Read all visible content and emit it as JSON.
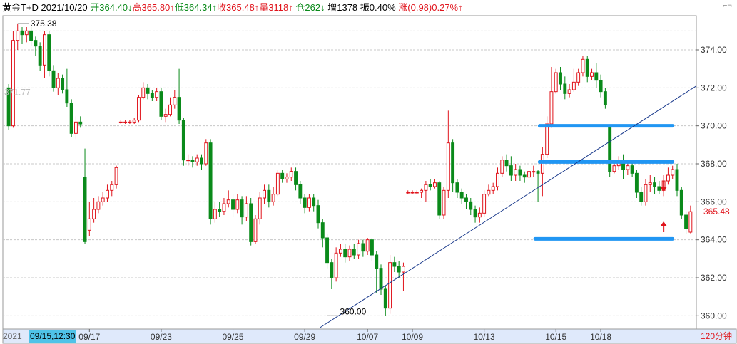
{
  "header": {
    "instrument": "黄金T+D",
    "date": "2021/10/20",
    "open": "开364.40↓",
    "high": "高365.80↑",
    "low": "低364.34↑",
    "close": "收365.48↑",
    "volume": "量3118↑",
    "position": "仓262↓",
    "increase": "增1378",
    "amplitude": "振0.40%",
    "change": "涨(0.98)0.27%↑"
  },
  "xbar": {
    "year": "2021",
    "cursor": "09/15,12:30",
    "period": "120分钟"
  },
  "colors": {
    "up": "#e0141c",
    "down": "#0a8a1a",
    "support_line": "#2196f3",
    "trend_line": "#1a3a8c",
    "grid": "#c8c8c8"
  },
  "chart_data": {
    "type": "candlestick",
    "title": "",
    "xlabel": "",
    "ylabel": "",
    "ylim": [
      359.3,
      375.8
    ],
    "yticks": [
      360.0,
      362.0,
      364.0,
      366.0,
      368.0,
      370.0,
      372.0,
      374.0
    ],
    "ytick_labels": [
      "360.00",
      "362.00",
      "364.00",
      "366.00",
      "368.00",
      "370.00",
      "372.00",
      "374.00"
    ],
    "xtick_labels": [
      {
        "index": 18,
        "label": "09/17"
      },
      {
        "index": 34,
        "label": "09/23"
      },
      {
        "index": 50,
        "label": "09/25"
      },
      {
        "index": 66,
        "label": "09/29"
      },
      {
        "index": 80,
        "label": "10/07"
      },
      {
        "index": 90,
        "label": "10/09"
      },
      {
        "index": 106,
        "label": "10/13"
      },
      {
        "index": 122,
        "label": "10/15"
      },
      {
        "index": 132,
        "label": "10/18"
      }
    ],
    "annotations": [
      {
        "label": "375.38",
        "index": 2,
        "value": 375.38
      },
      {
        "label": "360.00",
        "index": 71,
        "value": 360.0
      },
      {
        "label": "371.77",
        "index": 0,
        "value": 371.77,
        "faded": true
      },
      {
        "label": "365.48",
        "value": 365.48,
        "kind": "last-price"
      }
    ],
    "support_lines": [
      {
        "value": 370.0,
        "from_index": 119,
        "to_index": 148
      },
      {
        "value": 368.1,
        "from_index": 119,
        "to_index": 148
      },
      {
        "value": 364.05,
        "from_index": 118,
        "to_index": 148
      }
    ],
    "trend_line": {
      "from": {
        "index": 71,
        "value": 359.6
      },
      "to": {
        "index": 148,
        "value": 372.1
      }
    },
    "arrows": [
      {
        "index": 146,
        "value": 366.8,
        "direction": "down"
      },
      {
        "index": 146,
        "value": 364.7,
        "direction": "up"
      }
    ],
    "candles": [
      [
        372.0,
        370.0,
        372.2,
        369.8
      ],
      [
        370.0,
        374.5,
        375.0,
        369.9
      ],
      [
        374.5,
        375.0,
        375.38,
        374.0
      ],
      [
        375.0,
        374.8,
        375.2,
        374.3
      ],
      [
        374.8,
        375.0,
        375.2,
        374.4
      ],
      [
        375.0,
        374.5,
        375.2,
        374.2
      ],
      [
        374.5,
        374.2,
        374.7,
        373.7
      ],
      [
        374.2,
        373.2,
        374.4,
        372.9
      ],
      [
        373.2,
        374.8,
        375.0,
        372.5
      ],
      [
        374.8,
        372.9,
        375.0,
        372.6
      ],
      [
        372.9,
        372.0,
        373.2,
        371.8
      ],
      [
        372.0,
        372.5,
        372.8,
        371.6
      ],
      [
        372.5,
        371.9,
        372.7,
        371.7
      ],
      [
        371.9,
        371.2,
        373.0,
        371.0
      ],
      [
        371.2,
        369.6,
        371.4,
        369.4
      ],
      [
        369.6,
        370.2,
        370.5,
        369.3
      ],
      [
        370.2,
        370.1,
        370.5,
        369.9
      ],
      [
        367.3,
        363.9,
        368.8,
        363.8
      ],
      [
        364.5,
        365.1,
        366.0,
        364.2
      ],
      [
        365.1,
        365.6,
        366.2,
        364.9
      ],
      [
        365.6,
        366.0,
        366.3,
        365.4
      ],
      [
        366.0,
        366.2,
        366.5,
        365.8
      ],
      [
        366.2,
        366.6,
        366.9,
        366.0
      ],
      [
        366.6,
        366.9,
        367.1,
        366.3
      ],
      [
        366.9,
        367.8,
        367.9,
        366.7
      ],
      [
        370.2,
        370.2,
        370.3,
        370.1
      ],
      [
        370.2,
        370.2,
        370.3,
        370.1
      ],
      [
        370.2,
        370.2,
        370.3,
        370.1
      ],
      [
        370.2,
        370.3,
        370.4,
        370.1
      ],
      [
        370.3,
        371.5,
        371.6,
        370.2
      ],
      [
        371.5,
        372.0,
        372.3,
        371.4
      ],
      [
        372.0,
        371.7,
        372.2,
        371.4
      ],
      [
        371.7,
        371.5,
        371.9,
        371.3
      ],
      [
        371.5,
        371.8,
        372.0,
        371.3
      ],
      [
        371.8,
        370.5,
        372.0,
        370.3
      ],
      [
        370.5,
        370.6,
        370.9,
        370.2
      ],
      [
        370.6,
        371.1,
        371.5,
        370.5
      ],
      [
        371.1,
        371.5,
        371.9,
        370.9
      ],
      [
        371.5,
        370.3,
        373.0,
        370.1
      ],
      [
        370.3,
        368.2,
        370.4,
        367.9
      ],
      [
        368.2,
        368.2,
        368.5,
        367.9
      ],
      [
        368.2,
        368.1,
        368.4,
        367.8
      ],
      [
        368.1,
        368.3,
        368.5,
        367.9
      ],
      [
        368.3,
        368.0,
        368.5,
        367.7
      ],
      [
        368.0,
        369.1,
        369.3,
        367.9
      ],
      [
        369.1,
        365.1,
        369.3,
        364.8
      ],
      [
        365.1,
        365.6,
        366.0,
        364.9
      ],
      [
        365.6,
        365.5,
        366.0,
        365.2
      ],
      [
        365.5,
        365.9,
        366.2,
        365.3
      ],
      [
        365.9,
        366.1,
        366.6,
        365.7
      ],
      [
        366.1,
        365.6,
        366.4,
        365.2
      ],
      [
        365.6,
        366.1,
        366.4,
        365.4
      ],
      [
        366.1,
        365.2,
        366.3,
        364.8
      ],
      [
        365.2,
        365.9,
        366.3,
        365.0
      ],
      [
        365.9,
        363.9,
        366.2,
        363.7
      ],
      [
        363.9,
        365.1,
        365.3,
        363.8
      ],
      [
        365.1,
        366.2,
        366.5,
        364.8
      ],
      [
        366.2,
        366.6,
        366.9,
        365.9
      ],
      [
        366.6,
        366.0,
        366.9,
        365.7
      ],
      [
        366.0,
        366.4,
        366.8,
        365.8
      ],
      [
        366.4,
        367.5,
        367.7,
        366.3
      ],
      [
        367.5,
        367.2,
        367.7,
        367.0
      ],
      [
        367.2,
        367.3,
        367.5,
        367.0
      ],
      [
        367.3,
        367.6,
        367.8,
        367.1
      ],
      [
        367.6,
        366.9,
        367.8,
        366.6
      ],
      [
        366.9,
        366.2,
        367.1,
        365.9
      ],
      [
        366.2,
        365.7,
        366.4,
        365.4
      ],
      [
        365.7,
        366.2,
        366.4,
        365.5
      ],
      [
        366.2,
        365.8,
        366.4,
        365.5
      ],
      [
        365.8,
        364.9,
        366.1,
        364.6
      ],
      [
        364.9,
        364.1,
        365.1,
        363.6
      ],
      [
        364.1,
        362.8,
        364.3,
        362.5
      ],
      [
        362.8,
        362.0,
        363.0,
        361.4
      ],
      [
        362.0,
        363.3,
        363.6,
        361.8
      ],
      [
        363.3,
        363.5,
        363.8,
        363.1
      ],
      [
        363.5,
        363.1,
        363.8,
        362.8
      ],
      [
        363.1,
        363.5,
        363.7,
        362.9
      ],
      [
        363.5,
        363.2,
        363.8,
        363.0
      ],
      [
        363.2,
        363.8,
        364.0,
        363.0
      ],
      [
        363.8,
        363.4,
        364.0,
        363.1
      ],
      [
        363.4,
        364.0,
        364.1,
        363.2
      ],
      [
        364.0,
        363.2,
        364.1,
        362.9
      ],
      [
        363.2,
        362.5,
        363.4,
        361.2
      ],
      [
        362.5,
        361.4,
        362.7,
        361.1
      ],
      [
        361.4,
        360.4,
        361.6,
        360.0
      ],
      [
        360.4,
        362.8,
        363.2,
        360.1
      ],
      [
        362.8,
        362.6,
        363.1,
        362.3
      ],
      [
        362.6,
        362.3,
        362.9,
        362.0
      ],
      [
        362.3,
        362.6,
        362.8,
        361.3
      ],
      [
        366.5,
        366.5,
        366.6,
        366.4
      ],
      [
        366.5,
        366.5,
        366.6,
        366.4
      ],
      [
        366.5,
        366.5,
        366.6,
        366.4
      ],
      [
        366.5,
        366.6,
        366.7,
        366.2
      ],
      [
        366.6,
        366.9,
        367.1,
        366.0
      ],
      [
        366.9,
        366.8,
        367.2,
        366.6
      ],
      [
        366.8,
        367.0,
        367.2,
        366.7
      ],
      [
        367.0,
        365.3,
        367.1,
        365.1
      ],
      [
        365.3,
        366.6,
        366.8,
        365.1
      ],
      [
        366.6,
        369.1,
        370.8,
        366.2
      ],
      [
        369.1,
        367.0,
        369.3,
        366.5
      ],
      [
        367.0,
        366.5,
        367.2,
        366.2
      ],
      [
        366.5,
        366.2,
        366.7,
        365.9
      ],
      [
        366.2,
        366.0,
        366.4,
        365.6
      ],
      [
        366.0,
        365.6,
        366.2,
        365.3
      ],
      [
        365.6,
        365.2,
        365.8,
        364.9
      ],
      [
        365.2,
        365.4,
        365.7,
        364.9
      ],
      [
        365.4,
        366.4,
        366.6,
        365.2
      ],
      [
        366.4,
        366.6,
        366.9,
        366.3
      ],
      [
        366.6,
        366.8,
        367.0,
        366.4
      ],
      [
        366.8,
        367.5,
        367.8,
        366.6
      ],
      [
        367.5,
        368.2,
        368.4,
        367.3
      ],
      [
        368.2,
        367.9,
        368.5,
        367.6
      ],
      [
        367.9,
        367.4,
        368.4,
        367.1
      ],
      [
        367.4,
        367.7,
        368.0,
        367.1
      ],
      [
        367.7,
        367.4,
        367.9,
        367.1
      ],
      [
        367.4,
        367.3,
        367.6,
        367.0
      ],
      [
        367.3,
        367.6,
        367.7,
        367.2
      ],
      [
        367.6,
        367.6,
        367.9,
        367.3
      ],
      [
        367.6,
        367.5,
        367.7,
        366.0
      ],
      [
        367.5,
        368.5,
        368.9,
        366.3
      ],
      [
        368.5,
        370.1,
        370.5,
        368.3
      ],
      [
        370.1,
        371.8,
        373.1,
        369.9
      ],
      [
        371.8,
        372.8,
        373.0,
        371.7
      ],
      [
        372.8,
        372.2,
        373.1,
        371.9
      ],
      [
        372.2,
        371.7,
        372.6,
        371.4
      ],
      [
        371.7,
        371.9,
        372.2,
        371.5
      ],
      [
        371.9,
        372.3,
        373.0,
        371.8
      ],
      [
        372.3,
        372.8,
        373.0,
        372.1
      ],
      [
        372.8,
        373.5,
        373.7,
        372.6
      ],
      [
        373.5,
        372.6,
        373.7,
        372.3
      ],
      [
        372.6,
        372.8,
        373.0,
        372.4
      ],
      [
        372.8,
        372.4,
        373.3,
        372.0
      ],
      [
        372.4,
        371.8,
        372.7,
        371.5
      ],
      [
        371.8,
        371.1,
        372.0,
        370.9
      ],
      [
        369.9,
        367.6,
        370.0,
        367.3
      ],
      [
        367.6,
        367.9,
        368.2,
        367.5
      ],
      [
        367.9,
        368.1,
        368.4,
        367.7
      ],
      [
        368.1,
        367.7,
        368.5,
        367.2
      ],
      [
        367.7,
        367.9,
        368.2,
        367.4
      ],
      [
        367.9,
        367.5,
        368.2,
        367.3
      ],
      [
        367.5,
        366.5,
        367.7,
        366.2
      ],
      [
        366.5,
        366.0,
        366.8,
        365.8
      ],
      [
        366.0,
        366.9,
        367.2,
        365.8
      ],
      [
        366.9,
        367.0,
        367.4,
        366.5
      ],
      [
        367.0,
        366.8,
        367.3,
        366.4
      ],
      [
        366.8,
        366.6,
        367.1,
        366.4
      ],
      [
        366.6,
        367.1,
        367.4,
        366.3
      ],
      [
        367.1,
        367.4,
        367.8,
        366.9
      ],
      [
        367.4,
        367.7,
        367.9,
        367.2
      ],
      [
        367.7,
        366.6,
        368.0,
        366.3
      ],
      [
        366.6,
        365.3,
        366.8,
        365.1
      ],
      [
        365.3,
        364.6,
        365.5,
        364.3
      ],
      [
        364.4,
        365.48,
        365.8,
        364.34
      ]
    ]
  }
}
